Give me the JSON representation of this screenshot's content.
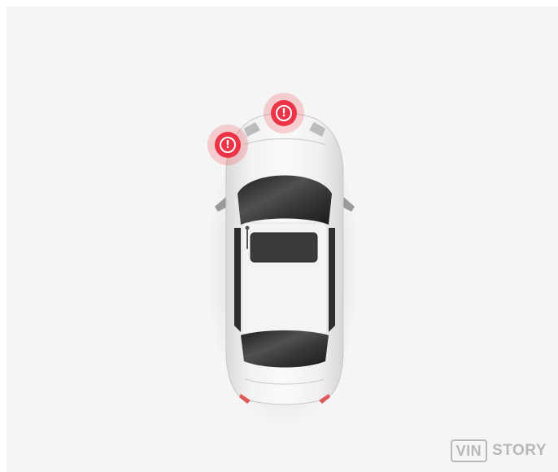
{
  "diagram": {
    "markers": [
      {
        "icon": "exclamation",
        "label": "!",
        "color": "#ec3446"
      },
      {
        "icon": "exclamation",
        "label": "!",
        "color": "#ec3446"
      }
    ]
  },
  "brand": {
    "logo_part1": "VIN",
    "logo_part2": "STORY",
    "color": "#b8b8b8"
  }
}
